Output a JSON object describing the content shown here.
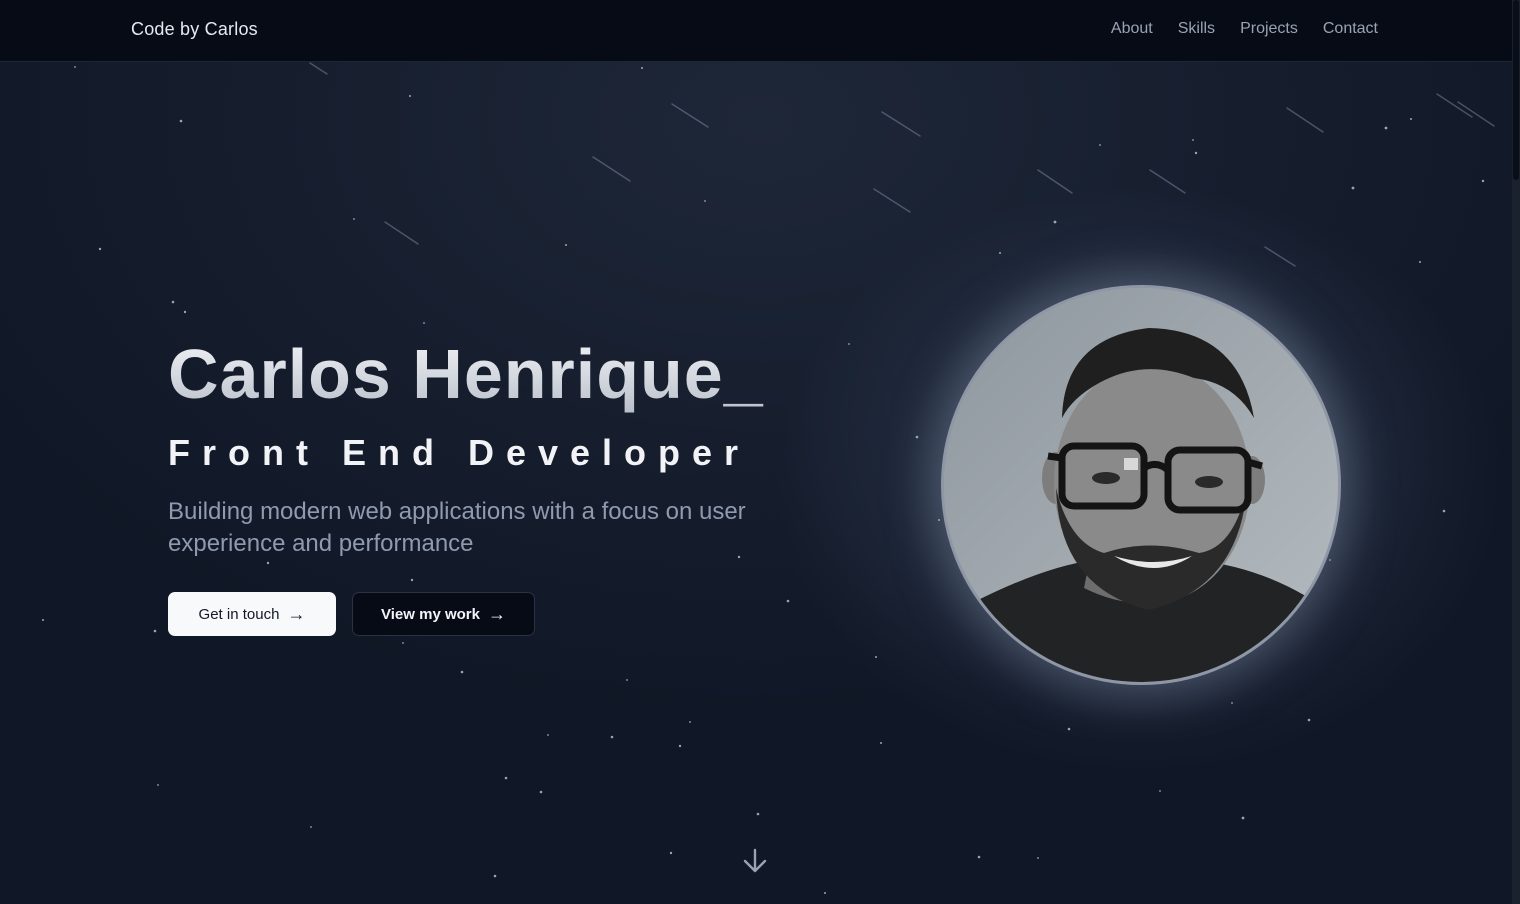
{
  "navbar": {
    "brand": "Code by Carlos",
    "links": [
      {
        "label": "About"
      },
      {
        "label": "Skills"
      },
      {
        "label": "Projects"
      },
      {
        "label": "Contact"
      }
    ]
  },
  "hero": {
    "name": "Carlos Henrique_",
    "role": "Front End Developer",
    "description": "Building modern web applications with a focus on user experience and performance",
    "primary_button": {
      "label": "Get in touch",
      "arrow": "→"
    },
    "secondary_button": {
      "label": "View my work",
      "arrow": "→"
    }
  },
  "avatar": {
    "icon": "profile-photo"
  },
  "scroll_indicator": {
    "icon": "arrow-down-icon"
  },
  "colors": {
    "background": "#161e2e",
    "navbar": "#070b16",
    "primary_button_bg": "#f8f9fb",
    "secondary_button_bg": "#070b16",
    "muted_text": "#8f9aae"
  }
}
